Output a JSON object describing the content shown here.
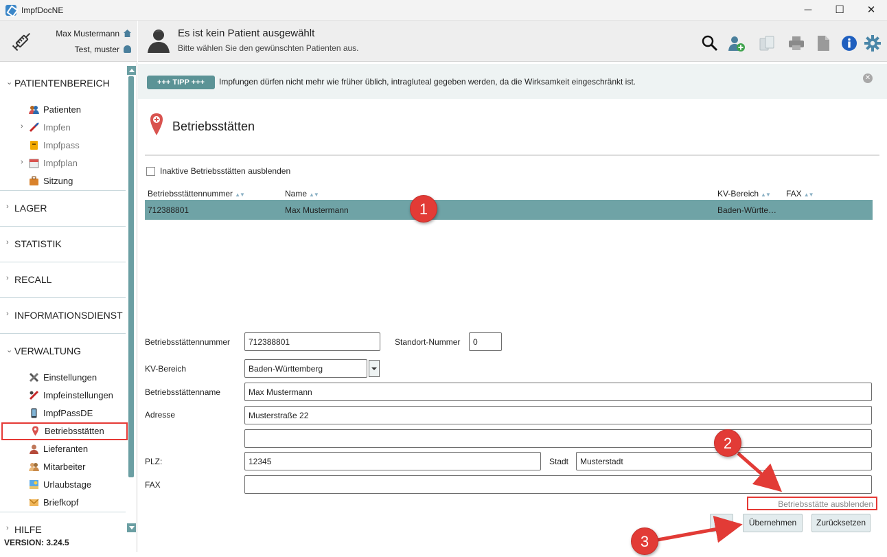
{
  "window": {
    "title": "ImpfDocNE",
    "minimize": "─",
    "maximize": "☐",
    "close": "✕"
  },
  "user": {
    "name": "Max Mustermann",
    "sub": "Test, muster"
  },
  "patient": {
    "title": "Es ist kein Patient ausgewählt",
    "subtitle": "Bitte wählen Sie den gewünschten Patienten aus."
  },
  "header_icons": [
    "search-icon",
    "add-patient-icon",
    "copy-icon",
    "print-icon",
    "document-icon",
    "info-icon",
    "settings-icon"
  ],
  "sidebar": {
    "sections": [
      {
        "label": "PATIENTENBEREICH",
        "chevron": "⌄"
      },
      {
        "label": "LAGER",
        "chevron": "›"
      },
      {
        "label": "STATISTIK",
        "chevron": "›"
      },
      {
        "label": "RECALL",
        "chevron": "›"
      },
      {
        "label": "INFORMATIONSDIENST",
        "chevron": "›"
      },
      {
        "label": "VERWALTUNG",
        "chevron": "⌄"
      },
      {
        "label": "HILFE",
        "chevron": "›"
      }
    ],
    "patient_items": [
      {
        "label": "Patienten"
      },
      {
        "label": "Impfen"
      },
      {
        "label": "Impfpass"
      },
      {
        "label": "Impfplan"
      },
      {
        "label": "Sitzung"
      }
    ],
    "admin_items": [
      {
        "label": "Einstellungen"
      },
      {
        "label": "Impfeinstellungen"
      },
      {
        "label": "ImpfPassDE"
      },
      {
        "label": "Betriebsstätten"
      },
      {
        "label": "Lieferanten"
      },
      {
        "label": "Mitarbeiter"
      },
      {
        "label": "Urlaubstage"
      },
      {
        "label": "Briefkopf"
      }
    ],
    "expander": "›",
    "version": "VERSION: 3.24.5"
  },
  "tip": {
    "badge": "+++ TIPP +++",
    "text": "Impfungen dürfen nicht mehr wie früher üblich, intragluteal gegeben werden, da die Wirksamkeit eingeschränkt ist.",
    "close": "✕"
  },
  "page": {
    "title": "Betriebsstätten",
    "hide_inactive_label": "Inaktive Betriebsstätten ausblenden",
    "hide_inactive_checked": false
  },
  "table": {
    "columns": [
      "Betriebsstättennummer",
      "Name",
      "KV-Bereich",
      "FAX"
    ],
    "sort_glyph": "▲▼",
    "rows": [
      {
        "nummer": "712388801",
        "name": "Max Mustermann",
        "kv": "Baden-Württe…",
        "fax": ""
      }
    ]
  },
  "form": {
    "nummer_label": "Betriebsstättennummer",
    "nummer_value": "712388801",
    "standort_label": "Standort-Nummer",
    "standort_value": "0",
    "kv_label": "KV-Bereich",
    "kv_value": "Baden-Württemberg",
    "name_label": "Betriebsstättenname",
    "name_value": "Max Mustermann",
    "adresse_label": "Adresse",
    "adresse_value": "Musterstraße 22",
    "adresse2_value": "",
    "plz_label": "PLZ:",
    "plz_value": "12345",
    "stadt_label": "Stadt",
    "stadt_value": "Musterstadt",
    "fax_label": "FAX",
    "fax_value": "",
    "hide_link": "Betriebsstätte ausblenden"
  },
  "buttons": {
    "neu": "Neu",
    "uebernehmen": "Übernehmen",
    "zuruecksetzen": "Zurücksetzen"
  },
  "annotations": [
    "1",
    "2",
    "3"
  ],
  "colors": {
    "accent": "#6fa3a6",
    "tip_badge": "#5b9396",
    "callout": "#e23b36",
    "highlight_border": "#e53935",
    "header_bg": "#eeeeee"
  }
}
